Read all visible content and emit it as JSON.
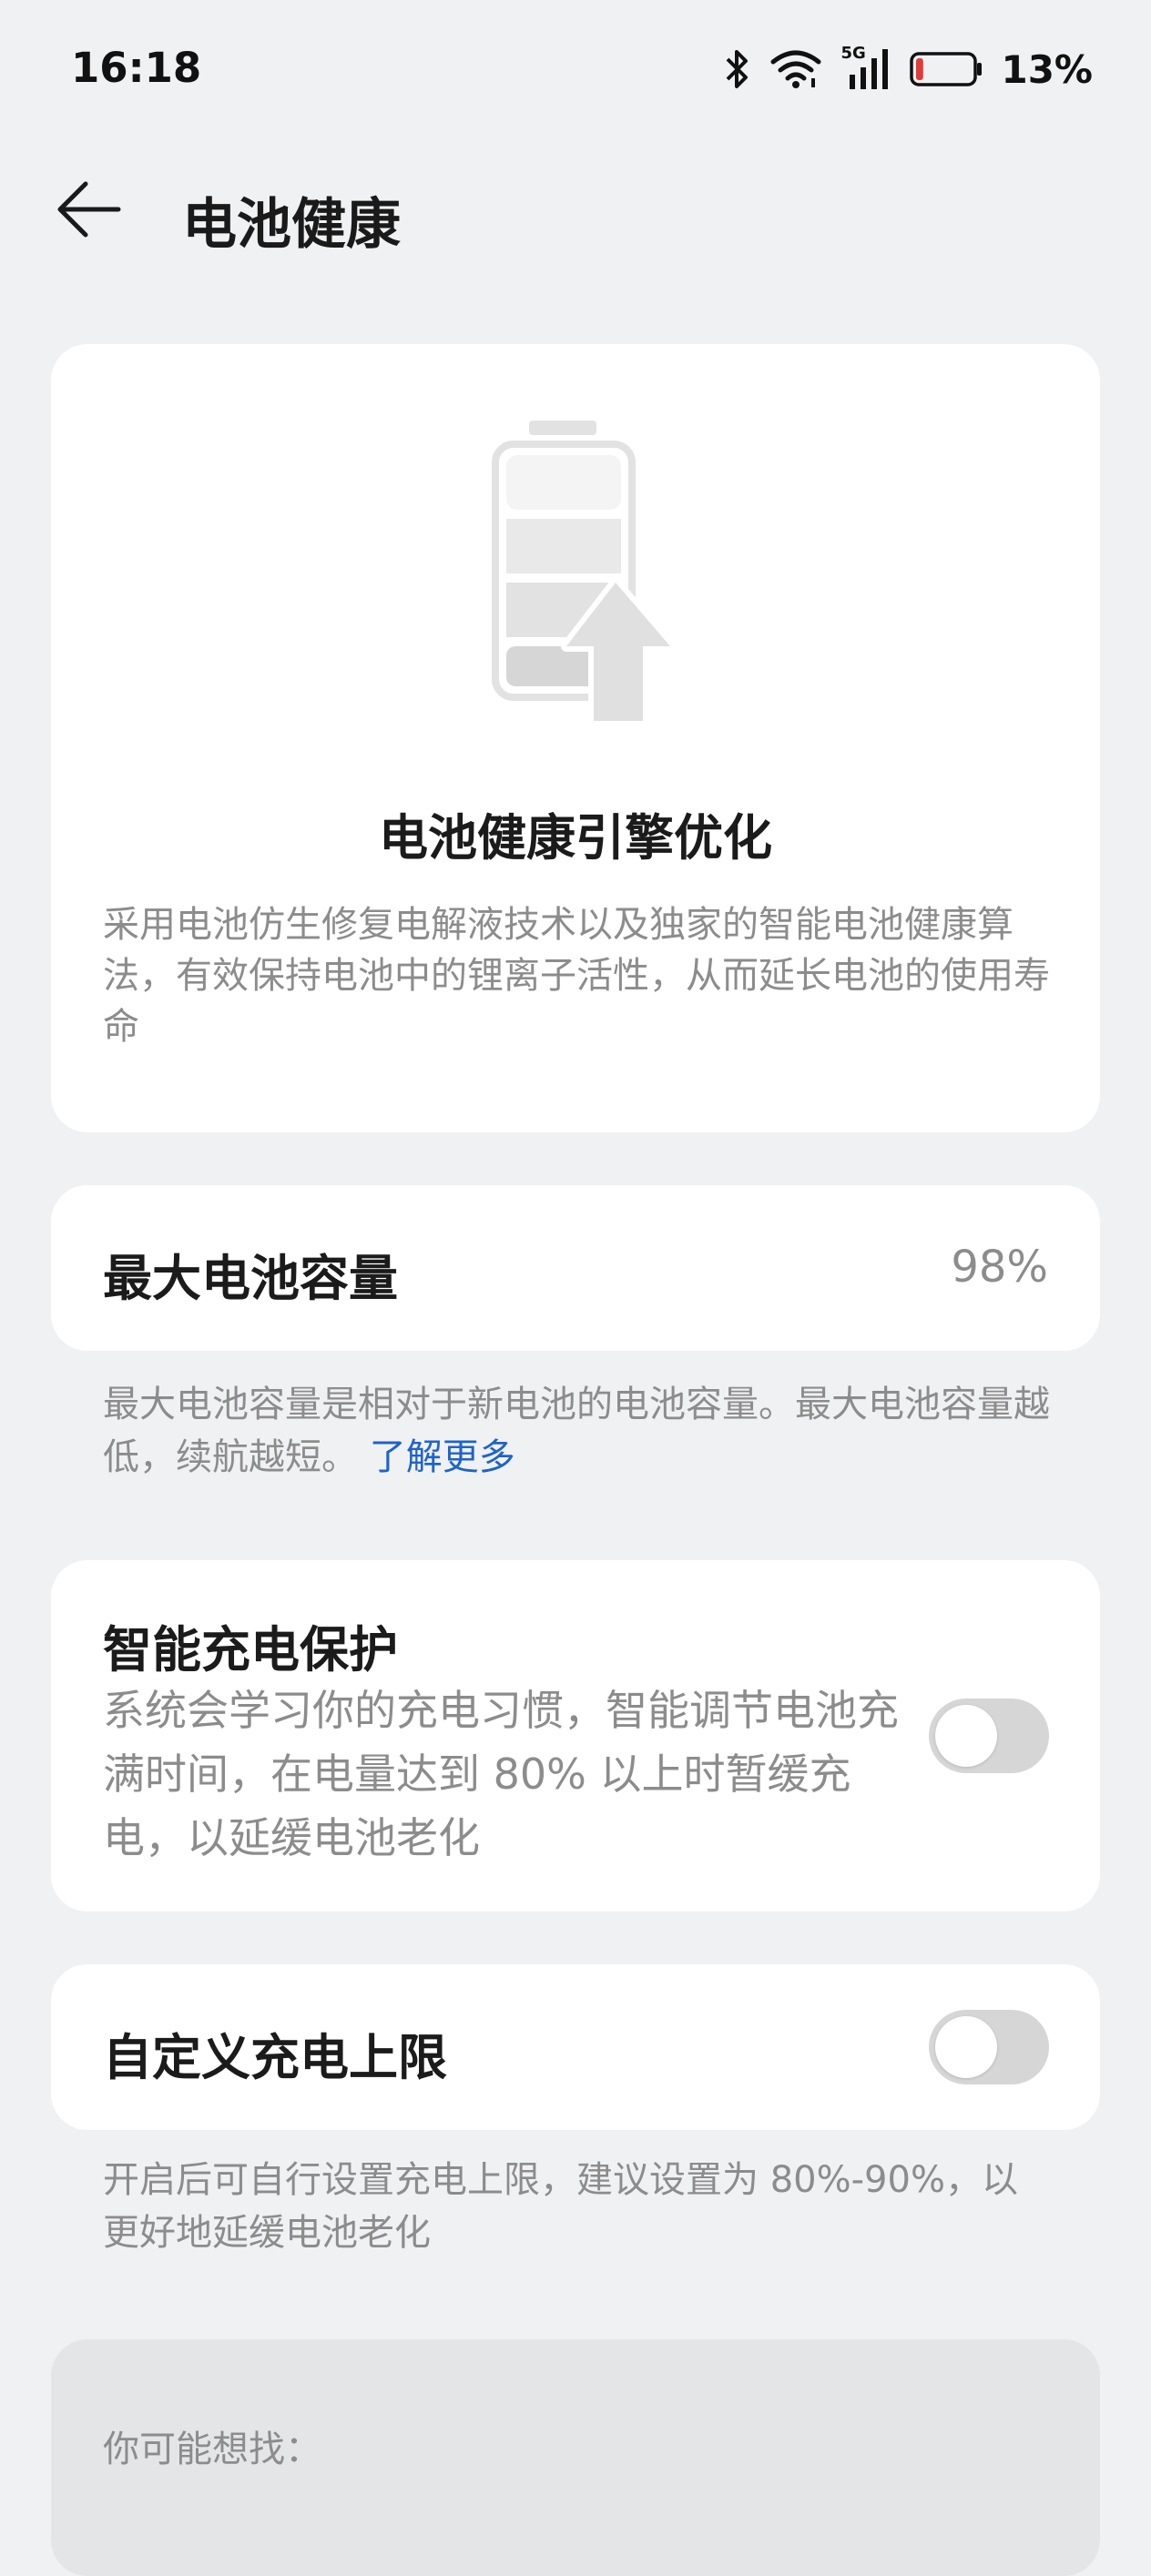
{
  "status_bar": {
    "time": "16:18",
    "battery_pct": "13%",
    "network": "5G",
    "battery_level": 0.13,
    "icons": [
      "bluetooth-icon",
      "wifi-icon",
      "signal-5g-icon",
      "battery-icon"
    ]
  },
  "header": {
    "title": "电池健康",
    "back_icon": "arrow-left-icon"
  },
  "hero": {
    "title": "电池健康引擎优化",
    "description": "采用电池仿生修复电解液技术以及独家的智能电池健康算法，有效保持电池中的锂离子活性，从而延长电池的使用寿命",
    "icon": "battery-boost-icon"
  },
  "capacity": {
    "label": "最大电池容量",
    "value": "98%",
    "note": "最大电池容量是相对于新电池的电池容量。最大电池容量越低，续航越短。",
    "learn_more": "了解更多"
  },
  "smart_charging": {
    "label": "智能充电保护",
    "description": "系统会学习你的充电习惯，智能调节电池充满时间，在电量达到 80% 以上时暂缓充电，以延缓电池老化",
    "enabled": false
  },
  "charge_limit": {
    "label": "自定义充电上限",
    "enabled": false,
    "note": "开启后可自行设置充电上限，建议设置为 80%-90%，以更好地延缓电池老化"
  },
  "suggestions": {
    "title": "你可能想找："
  },
  "colors": {
    "background": "#f0f1f3",
    "card": "#ffffff",
    "link": "#1f63c9",
    "battery_low": "#e23a3a",
    "toggle_off": "#d6d6d6"
  }
}
